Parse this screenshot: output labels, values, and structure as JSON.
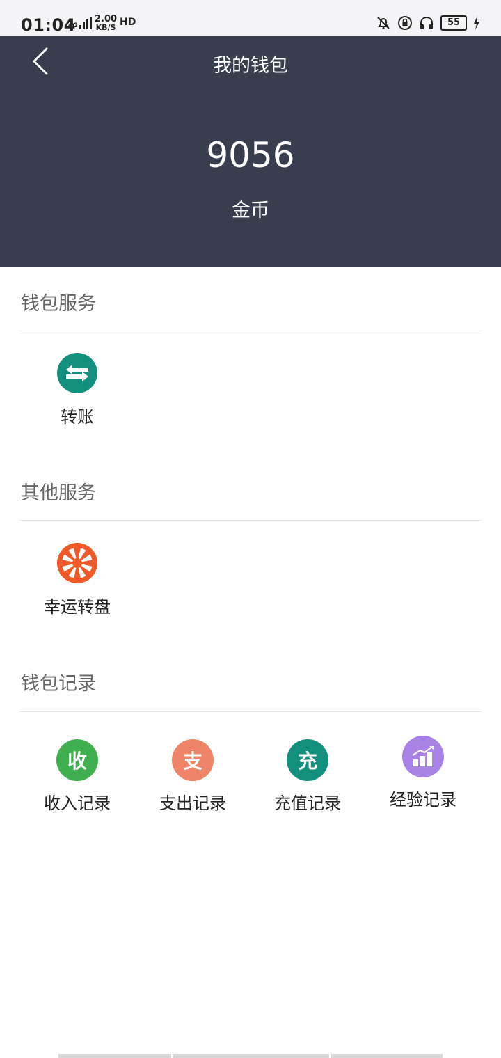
{
  "status_bar": {
    "time": "01:04",
    "network": "4G",
    "speed_value": "2.00",
    "speed_unit": "KB/S",
    "hd_label": "HD",
    "battery": "55"
  },
  "header": {
    "title": "我的钱包",
    "balance": "9056",
    "unit": "金币",
    "background": "#393e4e"
  },
  "sections": {
    "wallet_service": {
      "title": "钱包服务",
      "items": [
        {
          "label": "转账",
          "icon": "transfer-icon",
          "color": "#138f7e"
        }
      ]
    },
    "other_service": {
      "title": "其他服务",
      "items": [
        {
          "label": "幸运转盘",
          "icon": "lucky-wheel-icon",
          "color": "#f05a28"
        }
      ]
    },
    "wallet_records": {
      "title": "钱包记录",
      "items": [
        {
          "label": "收入记录",
          "icon_char": "收",
          "color": "#3fb04f"
        },
        {
          "label": "支出记录",
          "icon_char": "支",
          "color": "#f08468"
        },
        {
          "label": "充值记录",
          "icon_char": "充",
          "color": "#138f7e"
        },
        {
          "label": "经验记录",
          "icon": "bar-chart-icon",
          "color": "#a982e6"
        }
      ]
    }
  }
}
